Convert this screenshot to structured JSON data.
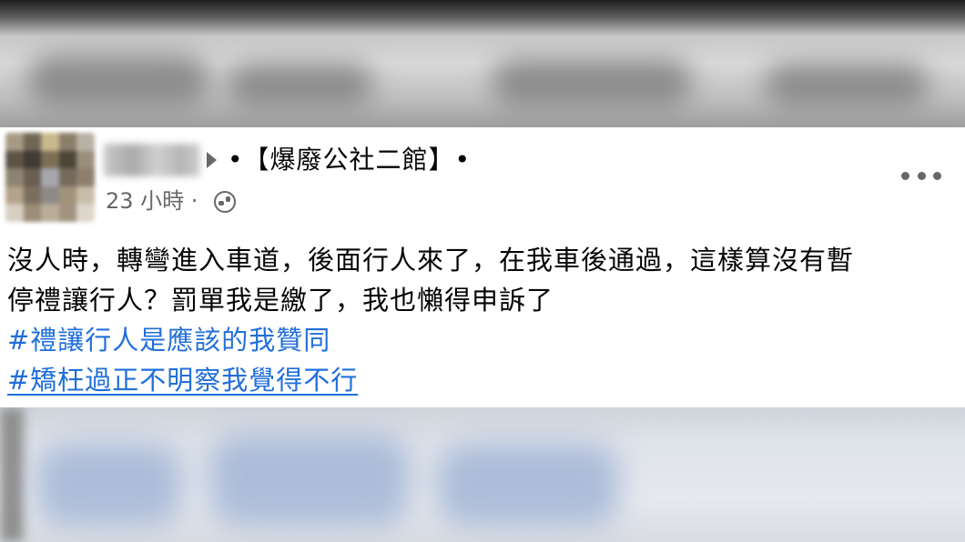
{
  "post": {
    "group_prefix": "•【",
    "group_name": "爆廢公社二館",
    "group_suffix": "】•",
    "time": "23 小時 ·",
    "privacy_icon": "globe-icon",
    "more_icon": "more-horizontal-icon",
    "body_line1": "沒人時，轉彎進入車道，後面行人來了，在我車後通過，這樣算沒有暫",
    "body_line2": "停禮讓行人？罰單我是繳了，我也懶得申訴了",
    "hashtags": [
      "#禮讓行人是應該的我贊同",
      "#矯枉過正不明察我覺得不行"
    ]
  },
  "colors": {
    "text": "#050505",
    "secondary": "#65676b",
    "hashtag": "#216fdb",
    "card": "#ffffff"
  }
}
